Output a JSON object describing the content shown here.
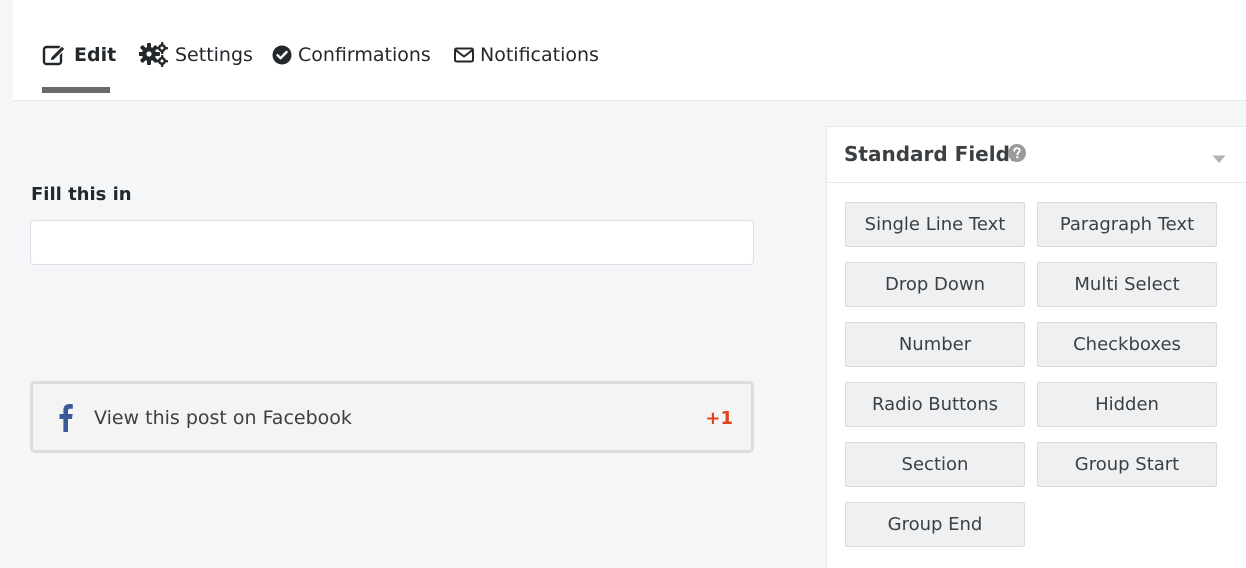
{
  "tabs": [
    {
      "label": "Edit",
      "icon": "edit-icon",
      "active": true
    },
    {
      "label": "Settings",
      "icon": "gears-icon",
      "active": false
    },
    {
      "label": "Confirmations",
      "icon": "check-circle-icon",
      "active": false
    },
    {
      "label": "Notifications",
      "icon": "envelope-icon",
      "active": false
    }
  ],
  "form": {
    "field_label": "Fill this in",
    "input_value": "",
    "facebook": {
      "text": "View this post on Facebook",
      "count": "+1",
      "brand_color": "#3b5998",
      "count_color": "#e0431a"
    }
  },
  "panel": {
    "title": "Standard Fields",
    "buttons": [
      "Single Line Text",
      "Paragraph Text",
      "Drop Down",
      "Multi Select",
      "Number",
      "Checkboxes",
      "Radio Buttons",
      "Hidden",
      "Section",
      "Group Start",
      "Group End"
    ]
  }
}
